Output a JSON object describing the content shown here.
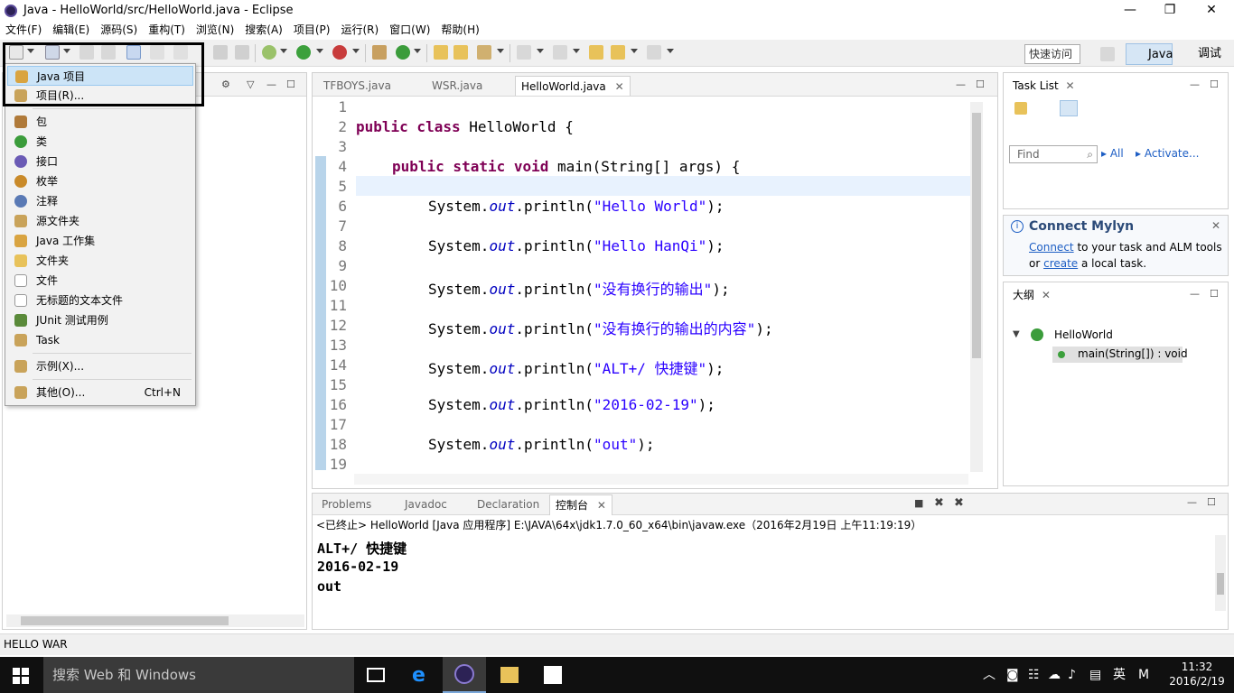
{
  "window": {
    "title": "Java - HelloWorld/src/HelloWorld.java - Eclipse",
    "minimize": "—",
    "restore": "❐",
    "close": "✕"
  },
  "menubar": [
    "文件(F)",
    "编辑(E)",
    "源码(S)",
    "重构(T)",
    "浏览(N)",
    "搜索(A)",
    "项目(P)",
    "运行(R)",
    "窗口(W)",
    "帮助(H)"
  ],
  "toolbar": {
    "quick_access": "快速访问",
    "perspective_java": "Java",
    "perspective_debug": "调试"
  },
  "new_menu": {
    "items": [
      {
        "label": "Java 项目",
        "icon": "java-project-icon",
        "color": "#d9a441"
      },
      {
        "label": "项目(R)...",
        "icon": "project-icon",
        "color": "#c9a35a"
      },
      {
        "label": "包",
        "icon": "package-icon",
        "color": "#b07a3a"
      },
      {
        "label": "类",
        "icon": "class-icon",
        "color": "#3b9c3b"
      },
      {
        "label": "接口",
        "icon": "interface-icon",
        "color": "#6b5bb5"
      },
      {
        "label": "枚举",
        "icon": "enum-icon",
        "color": "#c98a2a"
      },
      {
        "label": "注释",
        "icon": "annotation-icon",
        "color": "#5a7ab5"
      },
      {
        "label": "源文件夹",
        "icon": "source-folder-icon",
        "color": "#c9a35a"
      },
      {
        "label": "Java 工作集",
        "icon": "working-set-icon",
        "color": "#d9a441"
      },
      {
        "label": "文件夹",
        "icon": "folder-icon",
        "color": "#e8c25a"
      },
      {
        "label": "文件",
        "icon": "file-icon",
        "color": "#dddddd"
      },
      {
        "label": "无标题的文本文件",
        "icon": "text-file-icon",
        "color": "#dddddd"
      },
      {
        "label": "JUnit 测试用例",
        "icon": "junit-icon",
        "color": "#5a8a3a"
      },
      {
        "label": "Task",
        "icon": "task-icon",
        "color": "#c9a35a"
      },
      {
        "label": "示例(X)...",
        "icon": "example-icon",
        "color": "#c9a35a"
      },
      {
        "label": "其他(O)...",
        "icon": "other-icon",
        "color": "#c9a35a",
        "accel": "Ctrl+N"
      }
    ]
  },
  "editor": {
    "tabs": [
      "TFBOYS.java",
      "WSR.java",
      "HelloWorld.java"
    ],
    "active_tab": "HelloWorld.java",
    "line_numbers": [
      "1",
      "2",
      "3",
      "4",
      "5",
      "6",
      "7",
      "8",
      "9",
      "10",
      "11",
      "12",
      "13",
      "14",
      "15",
      "16",
      "17",
      "18",
      "19"
    ],
    "code": {
      "l2_kw": "public class ",
      "l2_rest": "HelloWorld {",
      "l4_kw": "public static void ",
      "l4_rest": "main(String[] args) {",
      "sys": "System.",
      "out": "out",
      "println": ".println(",
      "end": ");",
      "s6": "\"Hello World\"",
      "s8": "\"Hello HanQi\"",
      "s10": "\"没有换行的输出\"",
      "s12": "\"没有换行的输出的内容\"",
      "s14": "\"ALT+/ 快捷键\"",
      "s16": "\"2016-02-19\"",
      "s18": "\"out\""
    }
  },
  "console": {
    "tabs": [
      "Problems",
      "Javadoc",
      "Declaration",
      "控制台"
    ],
    "active_tab": "控制台",
    "header": "<已终止> HelloWorld [Java 应用程序] E:\\JAVA\\64x\\jdk1.7.0_60_x64\\bin\\javaw.exe（2016年2月19日 上午11:19:19）",
    "output": [
      "ALT+/ 快捷键",
      "2016-02-19",
      "out"
    ]
  },
  "tasklist": {
    "title": "Task List",
    "find_placeholder": "Find",
    "all": "All",
    "activate": "Activate..."
  },
  "mylyn": {
    "title": "Connect Mylyn",
    "connect": "Connect",
    "text1": " to your task and ALM tools",
    "or": "or ",
    "create": "create",
    "text2": " a local task."
  },
  "outline": {
    "title": "大纲",
    "class_name": "HelloWorld",
    "method": "main(String[]) : void"
  },
  "statusbar": {
    "text": "HELLO WAR"
  },
  "taskbar": {
    "search": "搜索 Web 和 Windows",
    "time": "11:32",
    "date": "2016/2/19",
    "ime": "英",
    "ime2": "M"
  }
}
